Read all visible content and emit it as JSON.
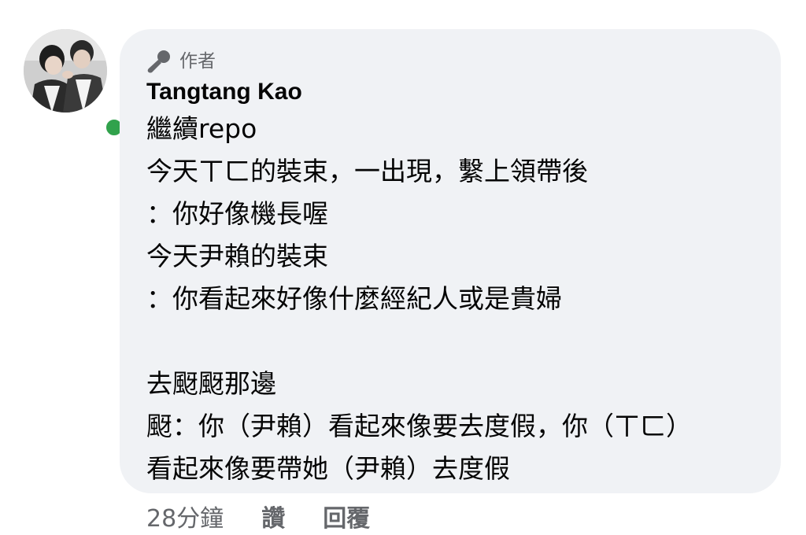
{
  "author": {
    "badge_label": "作者",
    "badge_icon": "microphone-icon",
    "name": "Tangtang Kao",
    "online_color": "#31a24c"
  },
  "comment": {
    "lines": [
      "繼續repo",
      "今天ㄒㄈ的裝束，一出現，繫上領帶後",
      "：你好像機長喔",
      "今天尹賴的裝束",
      "：你看起來好像什麼經紀人或是貴婦",
      "",
      "去颬颬那邊",
      "颬：你（尹賴）看起來像要去度假，你（ㄒㄈ）",
      "看起來像要帶她（尹賴）去度假"
    ]
  },
  "actions": {
    "time": "28分鐘",
    "like": "讚",
    "reply": "回覆"
  }
}
